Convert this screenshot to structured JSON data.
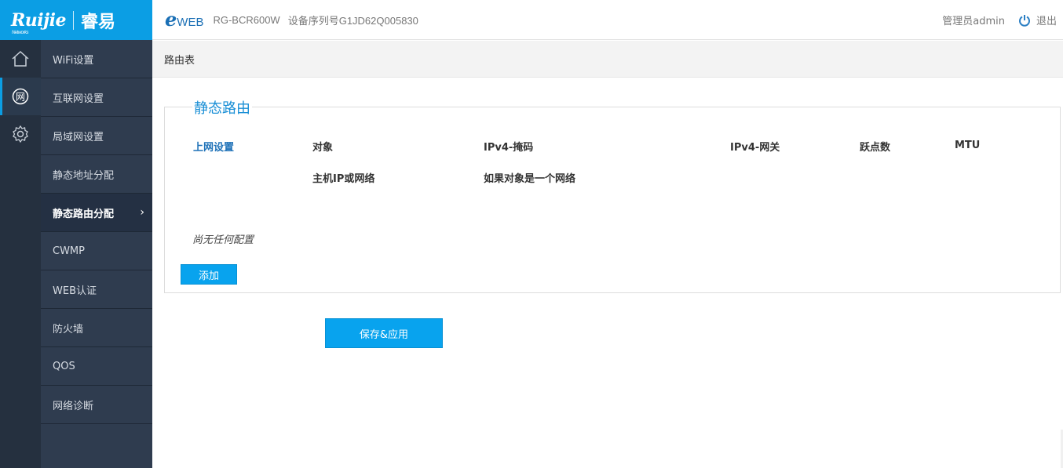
{
  "logo": {
    "brand": "Ruijie",
    "brand_sub": "Networks",
    "chinese": "睿易"
  },
  "header": {
    "eweb_e": "e",
    "eweb_text": "WEB",
    "model": "RG-BCR600W",
    "serial": "设备序列号G1JD62Q005830",
    "admin": "管理员admin",
    "logout": "退出"
  },
  "iconbar": {
    "network_glyph": "网",
    "icons": [
      "home-icon",
      "network-icon",
      "gear-icon"
    ]
  },
  "menu": {
    "items": [
      {
        "label": "WiFi设置"
      },
      {
        "label": "互联网设置"
      },
      {
        "label": "局域网设置"
      },
      {
        "label": "静态地址分配"
      },
      {
        "label": "静态路由分配",
        "active": true
      },
      {
        "label": "CWMP"
      },
      {
        "label": "WEB认证"
      },
      {
        "label": "防火墙"
      },
      {
        "label": "QOS"
      },
      {
        "label": "网络诊断"
      }
    ]
  },
  "breadcrumb": "路由表",
  "section": {
    "title": "静态路由",
    "columns": {
      "interface": "上网设置",
      "target": "对象",
      "target_sub": "主机IP或网络",
      "mask": "IPv4-掩码",
      "mask_sub": "如果对象是一个网络",
      "gateway": "IPv4-网关",
      "metric": "跃点数",
      "mtu": "MTU"
    },
    "empty_text": "尚无任何配置",
    "add_label": "添加"
  },
  "save_label": "保存&应用",
  "colors": {
    "accent": "#0b9ee4",
    "button": "#08a3ee",
    "sidebar": "#2f3c4f",
    "iconbar": "#25303f",
    "title_blue": "#1a8fd6"
  }
}
